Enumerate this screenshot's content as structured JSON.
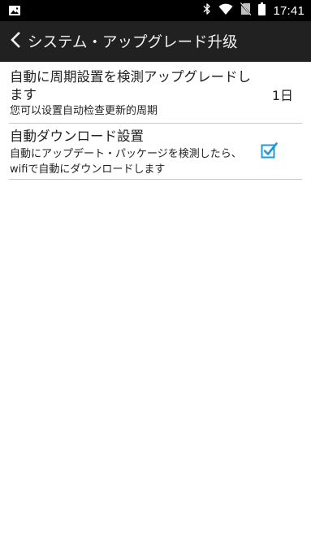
{
  "status_bar": {
    "time": "17:41",
    "icons": [
      "image-notification-icon",
      "bluetooth-icon",
      "wifi-icon",
      "no-sim-icon",
      "battery-icon"
    ]
  },
  "app_bar": {
    "title": "システム・アップグレード升级",
    "back_icon": "chevron-left-icon"
  },
  "settings": {
    "items": [
      {
        "title": "自動に周期設置を検測アップグレードします",
        "summary": "您可以设置自动检查更新的周期",
        "value": "1日"
      },
      {
        "title": "自動ダウンロード設置",
        "summary": "自動にアップデート・パッケージを検測したら、wifiで自動にダウンロードします",
        "checked": true
      }
    ]
  },
  "colors": {
    "status_bar_bg": "#000000",
    "app_bar_bg": "#212121",
    "accent": "#1e9bd7",
    "divider": "#c9c9c9"
  }
}
